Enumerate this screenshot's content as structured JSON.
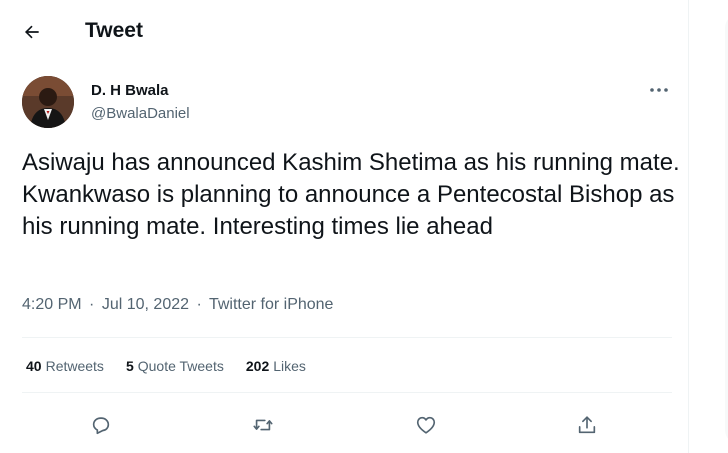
{
  "header": {
    "title": "Tweet",
    "back_icon": "arrow-left-icon"
  },
  "author": {
    "name": "D. H Bwala",
    "handle": "@BwalaDaniel",
    "more_icon": "more-horizontal-icon"
  },
  "tweet": {
    "text": "Asiwaju has announced Kashim Shetima as his running mate. Kwankwaso is planning to announce a Pentecostal Bishop as his running mate. Interesting times lie ahead",
    "time": "4:20 PM",
    "separator": "·",
    "date": "Jul 10, 2022",
    "source": "Twitter for iPhone"
  },
  "stats": {
    "retweets_count": "40",
    "retweets_label": "Retweets",
    "quotes_count": "5",
    "quotes_label": "Quote Tweets",
    "likes_count": "202",
    "likes_label": "Likes"
  },
  "actions": [
    {
      "icon": "reply-icon"
    },
    {
      "icon": "retweet-icon"
    },
    {
      "icon": "like-icon"
    },
    {
      "icon": "share-icon"
    }
  ],
  "colors": {
    "text": "#0f1419",
    "secondary": "#536471",
    "divider": "#eff3f4"
  }
}
